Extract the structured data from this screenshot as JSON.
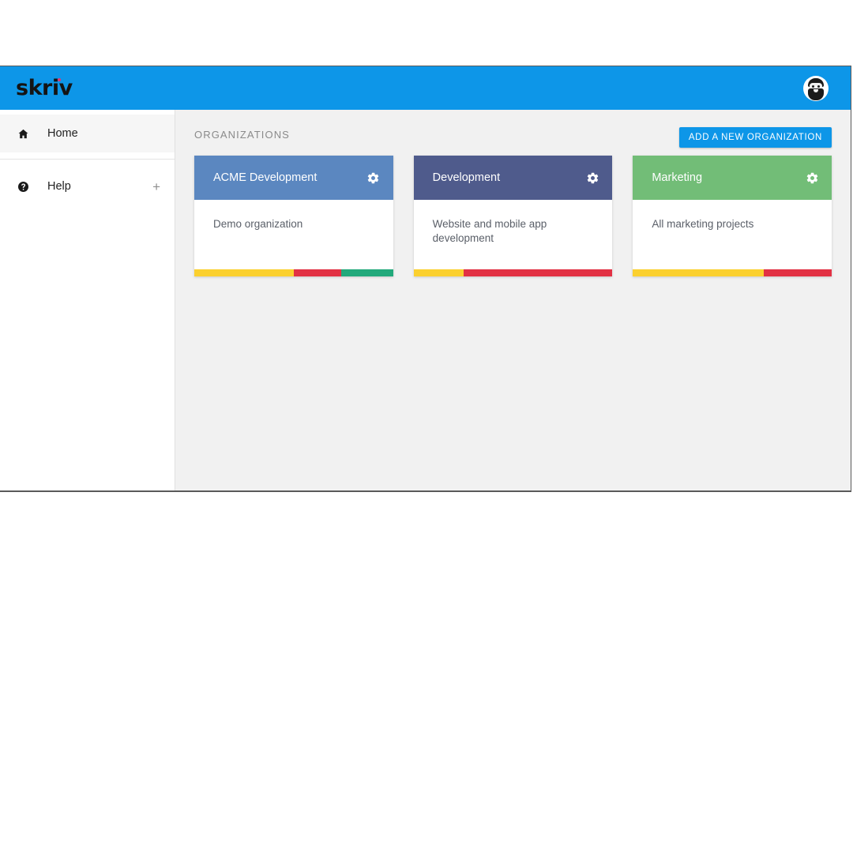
{
  "window": {
    "brand": "skriv",
    "brand_color": "#0d96e8"
  },
  "topbar": {
    "logo_text": "skriv",
    "avatar_name": "user-avatar"
  },
  "sidebar": {
    "items": [
      {
        "id": "home",
        "label": "Home",
        "icon": "home-icon",
        "active": true,
        "suffix": ""
      },
      {
        "id": "help",
        "label": "Help",
        "icon": "help-circle-icon",
        "active": false,
        "suffix": "+"
      }
    ]
  },
  "main": {
    "section_title": "ORGANIZATIONS",
    "add_button_label": "ADD A NEW ORGANIZATION",
    "cards": [
      {
        "title": "ACME Development",
        "description": "Demo organization",
        "header_color": "#5b87c0",
        "gear_icon": "gear-icon",
        "progress": [
          {
            "color": "#fbd02f",
            "percent": 50
          },
          {
            "color": "#e23144",
            "percent": 24
          },
          {
            "color": "#22a97b",
            "percent": 26
          }
        ]
      },
      {
        "title": "Development",
        "description": "Website and mobile app development",
        "header_color": "#4f5b8c",
        "gear_icon": "gear-icon",
        "progress": [
          {
            "color": "#fbd02f",
            "percent": 25
          },
          {
            "color": "#e23144",
            "percent": 75
          }
        ]
      },
      {
        "title": "Marketing",
        "description": "All marketing projects",
        "header_color": "#72bd77",
        "gear_icon": "gear-icon",
        "progress": [
          {
            "color": "#fbd02f",
            "percent": 66
          },
          {
            "color": "#e23144",
            "percent": 34
          }
        ]
      }
    ]
  }
}
